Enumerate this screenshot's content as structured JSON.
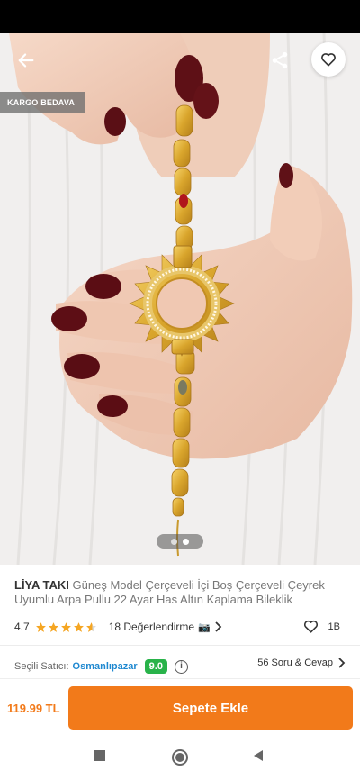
{
  "badge": "KARGO BEDAVA",
  "product": {
    "brand": "LİYA TAKI",
    "name": " Güneş Model Çerçeveli İçi Boş Çerçeveli Çeyrek Uyumlu Arpa Pullu 22 Ayar Has Altın Kaplama Bileklik"
  },
  "gallery": {
    "current_index": 1,
    "total": 2
  },
  "rating": {
    "value": "4.7",
    "stars": 4.7,
    "reviews": "18 Değerlendirme",
    "camera_icon": "📷"
  },
  "favorites": {
    "count": "1B"
  },
  "seller": {
    "label": "Seçili Satıcı:",
    "name": "Osmanlıpazar",
    "score": "9.0"
  },
  "qa": {
    "label": "56 Soru & Cevap"
  },
  "price": "119.99 TL",
  "add_to_cart": "Sepete Ekle",
  "colors": {
    "accent": "#f27a1a",
    "seller_link": "#1e88d0",
    "score_badge": "#29b34a",
    "star": "#f5a623"
  },
  "icons": [
    "back-arrow-icon",
    "share-icon",
    "heart-icon",
    "star-icon",
    "camera-icon",
    "chevron-right-icon",
    "info-icon",
    "nav-recents-icon",
    "nav-home-icon",
    "nav-back-icon"
  ]
}
